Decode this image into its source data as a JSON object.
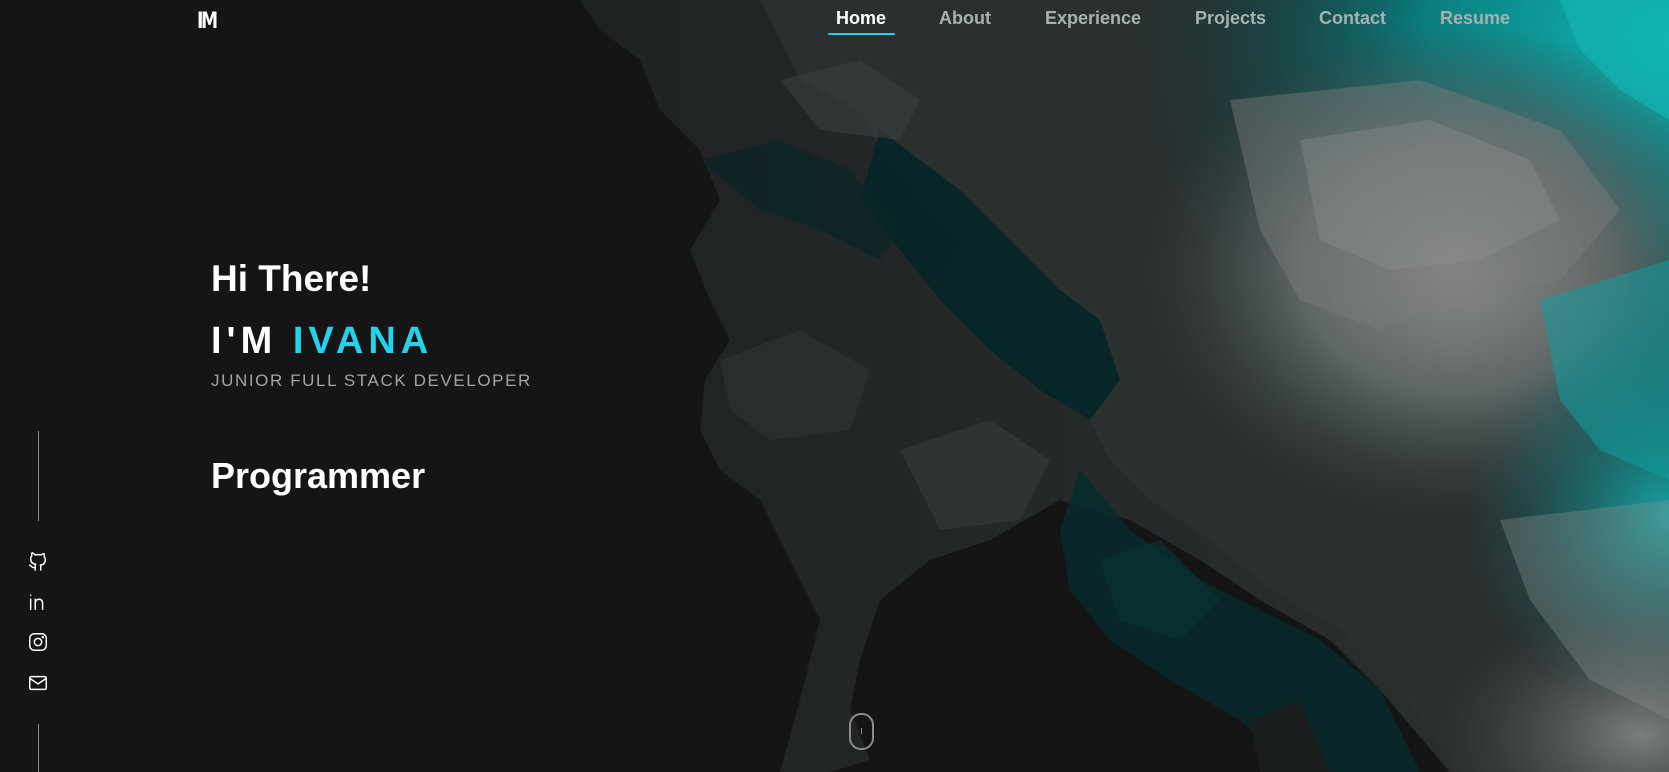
{
  "brand": {
    "logo_text": "IM"
  },
  "nav": {
    "links": [
      {
        "label": "Home",
        "active": true
      },
      {
        "label": "About"
      },
      {
        "label": "Experience"
      },
      {
        "label": "Projects"
      },
      {
        "label": "Contact"
      },
      {
        "label": "Resume"
      }
    ]
  },
  "hero": {
    "greeting": "Hi There!",
    "name_prefix": "I'M",
    "name": "IVANA",
    "subtitle": "JUNIOR FULL STACK DEVELOPER",
    "role": "Programmer"
  },
  "social": [
    "github-icon",
    "linkedin-icon",
    "instagram-icon",
    "mail-icon"
  ],
  "colors": {
    "background": "#151515",
    "accent": "#22d3ee",
    "nav_inactive": "#a8b0b0",
    "teal": "#0e9c9c"
  }
}
